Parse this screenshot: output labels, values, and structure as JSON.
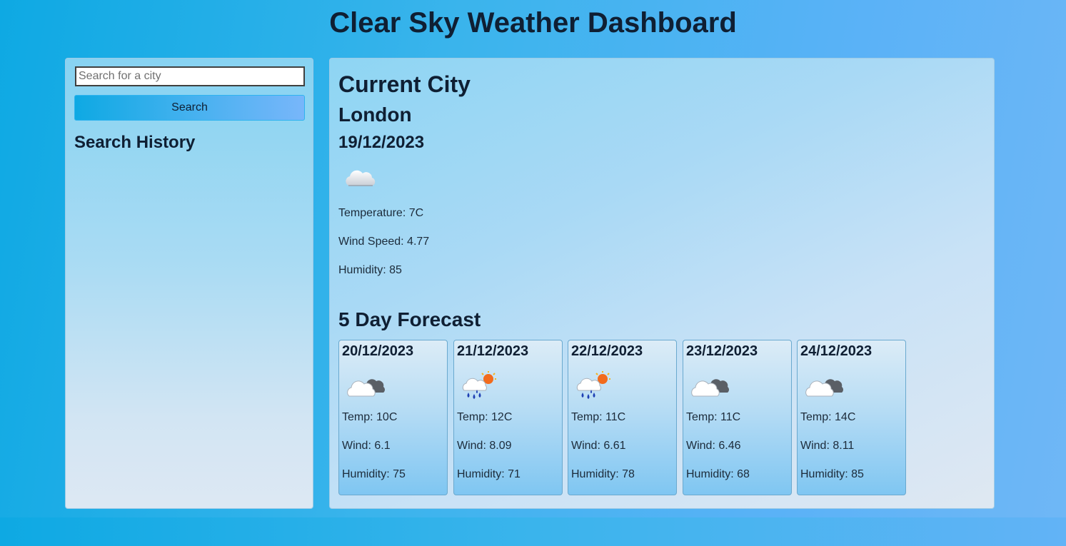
{
  "header": {
    "title": "Clear Sky Weather Dashboard"
  },
  "sidebar": {
    "search_placeholder": "Search for a city",
    "search_button": "Search",
    "history_title": "Search History"
  },
  "current": {
    "heading": "Current City",
    "city": "London",
    "date": "19/12/2023",
    "icon": "cloud-icon",
    "temperature": "Temperature: 7C",
    "wind": "Wind Speed: 4.77",
    "humidity": "Humidity: 85"
  },
  "forecast": {
    "heading": "5 Day Forecast",
    "days": [
      {
        "date": "20/12/2023",
        "icon": "partly-cloudy-icon",
        "temp": "Temp: 10C",
        "wind": "Wind: 6.1",
        "humidity": "Humidity: 75"
      },
      {
        "date": "21/12/2023",
        "icon": "rain-sun-icon",
        "temp": "Temp: 12C",
        "wind": "Wind: 8.09",
        "humidity": "Humidity: 71"
      },
      {
        "date": "22/12/2023",
        "icon": "rain-sun-icon",
        "temp": "Temp: 11C",
        "wind": "Wind: 6.61",
        "humidity": "Humidity: 78"
      },
      {
        "date": "23/12/2023",
        "icon": "partly-cloudy-icon",
        "temp": "Temp: 11C",
        "wind": "Wind: 6.46",
        "humidity": "Humidity: 68"
      },
      {
        "date": "24/12/2023",
        "icon": "partly-cloudy-icon",
        "temp": "Temp: 14C",
        "wind": "Wind: 8.11",
        "humidity": "Humidity: 85"
      }
    ]
  }
}
